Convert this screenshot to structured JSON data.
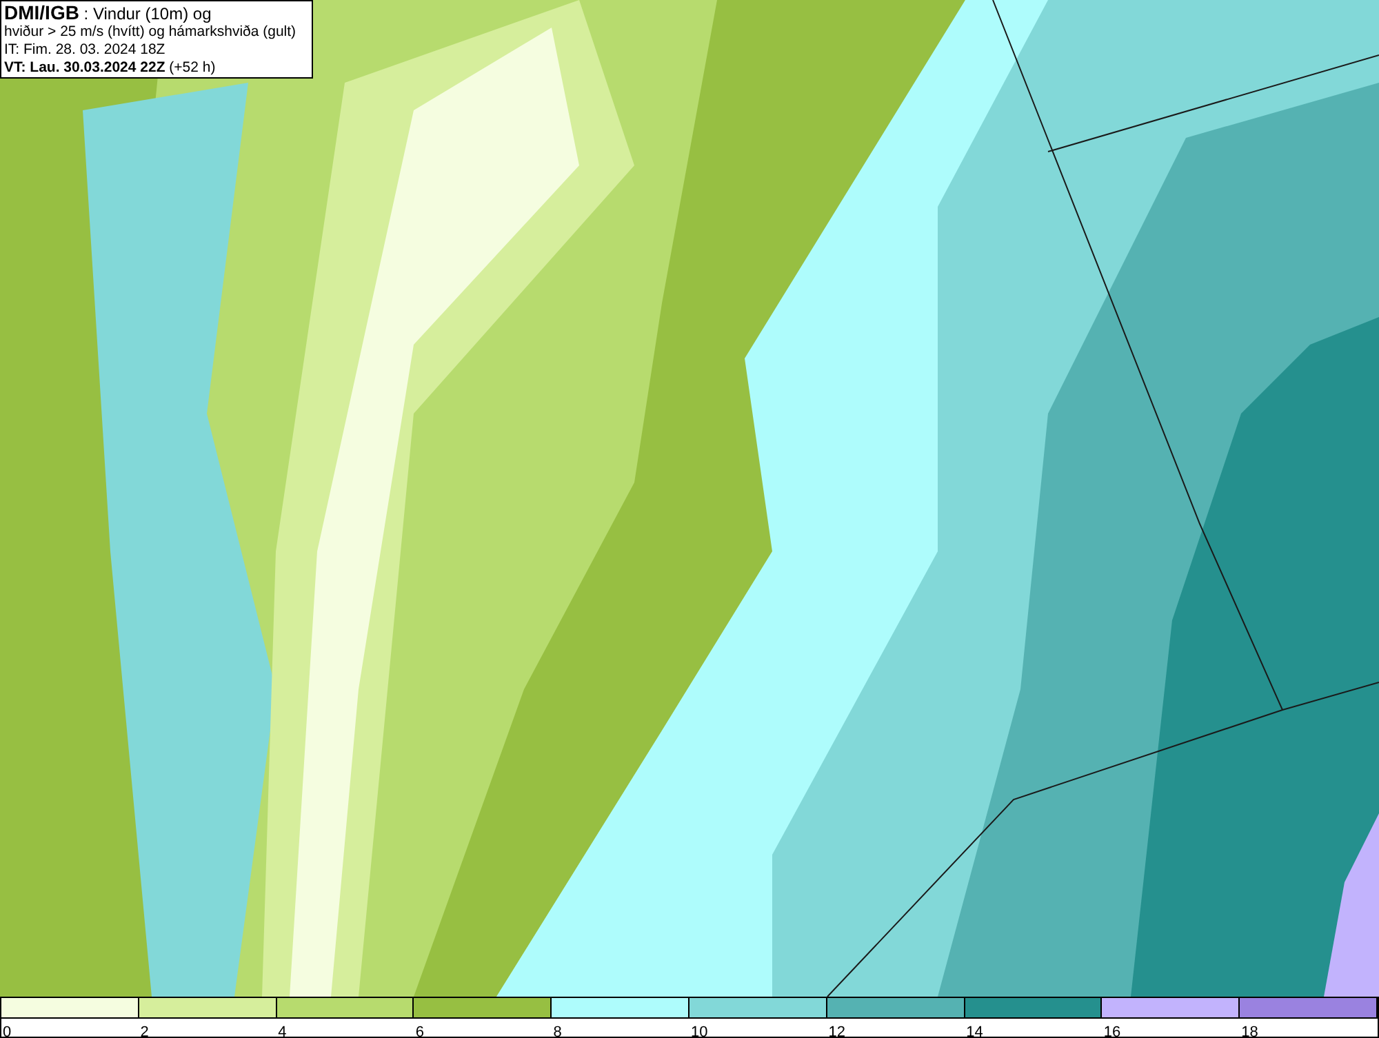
{
  "title_box": {
    "lines": [
      "**DMI/IGB** : Vindur (10m) og",
      "hviður > 25 m/s (hvítt) og hámarkshviða (gult)",
      "IT: Fim. 28. 03. 2024 18Z",
      "**VT: Lau. 30.03.2024 22Z** (+52 h)"
    ]
  },
  "legend": {
    "bins": [
      {
        "color": "#f5fde0"
      },
      {
        "color": "#d6ee9c"
      },
      {
        "color": "#b7db6e"
      },
      {
        "color": "#97bf42"
      },
      {
        "color": "#aefcfc"
      },
      {
        "color": "#82d8d8"
      },
      {
        "color": "#55b2b2"
      },
      {
        "color": "#25908e"
      },
      {
        "color": "#c2b3fd"
      },
      {
        "color": "#9a82e0"
      }
    ],
    "labels": [
      "0",
      "2",
      "4",
      "6",
      "8",
      "10",
      "12",
      "14",
      "16",
      "18"
    ]
  }
}
